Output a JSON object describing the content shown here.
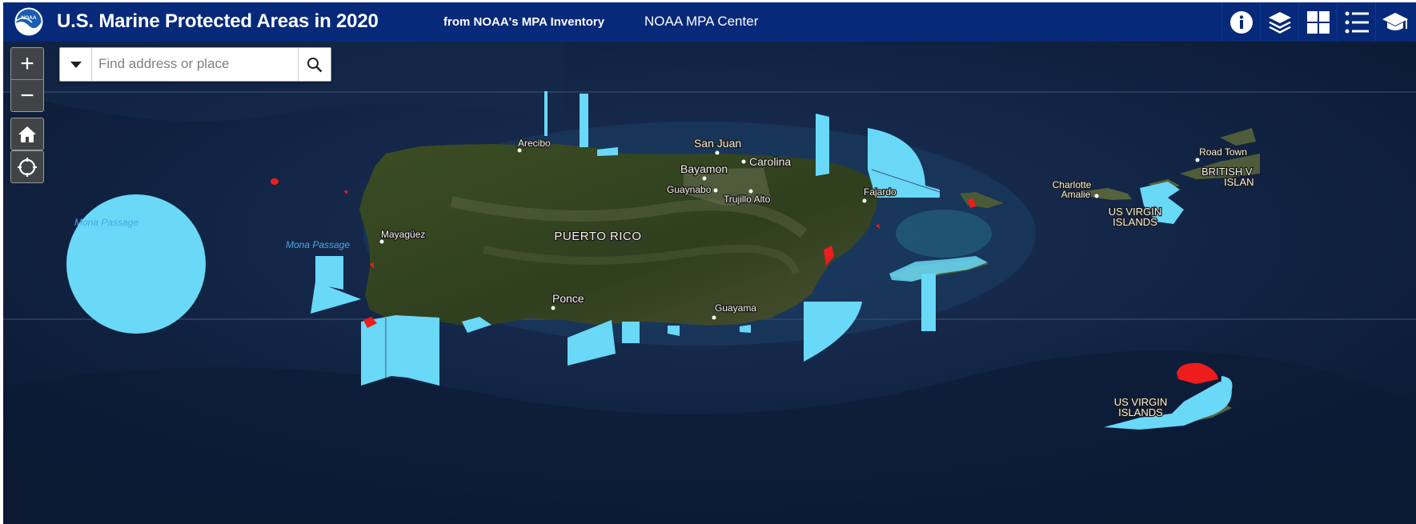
{
  "header": {
    "logo_text": "NOAA",
    "title": "U.S. Marine Protected Areas in 2020",
    "subtitle": "from NOAA's MPA Inventory",
    "link": "NOAA MPA Center",
    "buttons": [
      "info-icon",
      "layers-icon",
      "grid-icon",
      "legend-list-icon",
      "graduation-cap-icon"
    ]
  },
  "search": {
    "placeholder": "Find address or place"
  },
  "map_controls": {
    "zoom_in": "+",
    "zoom_out": "−",
    "home": "home-icon",
    "locate": "locate-icon"
  },
  "colors": {
    "header": "#06297a",
    "protected_area": "#6ad8f7",
    "highlight_area": "#ee1c1c",
    "ocean": "#0d1f3e",
    "land": "#33401e"
  },
  "labels": {
    "puerto_rico": "PUERTO RICO",
    "mona_passage_1": "Mona Passage",
    "mona_passage_2": "Mona Passage",
    "arecibo": "Arecibo",
    "san_juan": "San Juan",
    "carolina": "Carolina",
    "bayamon": "Bayamon",
    "guaynabo": "Guaynabo",
    "trujillo_alto": "Trujillo Alto",
    "fajardo": "Fajardo",
    "mayaguez": "Mayagüez",
    "ponce": "Ponce",
    "guayama": "Guayama",
    "charlotte_amalie_1": "Charlotte",
    "charlotte_amalie_2": "Amalie",
    "road_town": "Road Town",
    "bvi_1": "BRITISH V",
    "bvi_2": "ISLAN",
    "usvi_n_1": "US VIRGIN",
    "usvi_n_2": "ISLANDS",
    "usvi_s_1": "US VIRGIN",
    "usvi_s_2": "ISLANDS"
  }
}
